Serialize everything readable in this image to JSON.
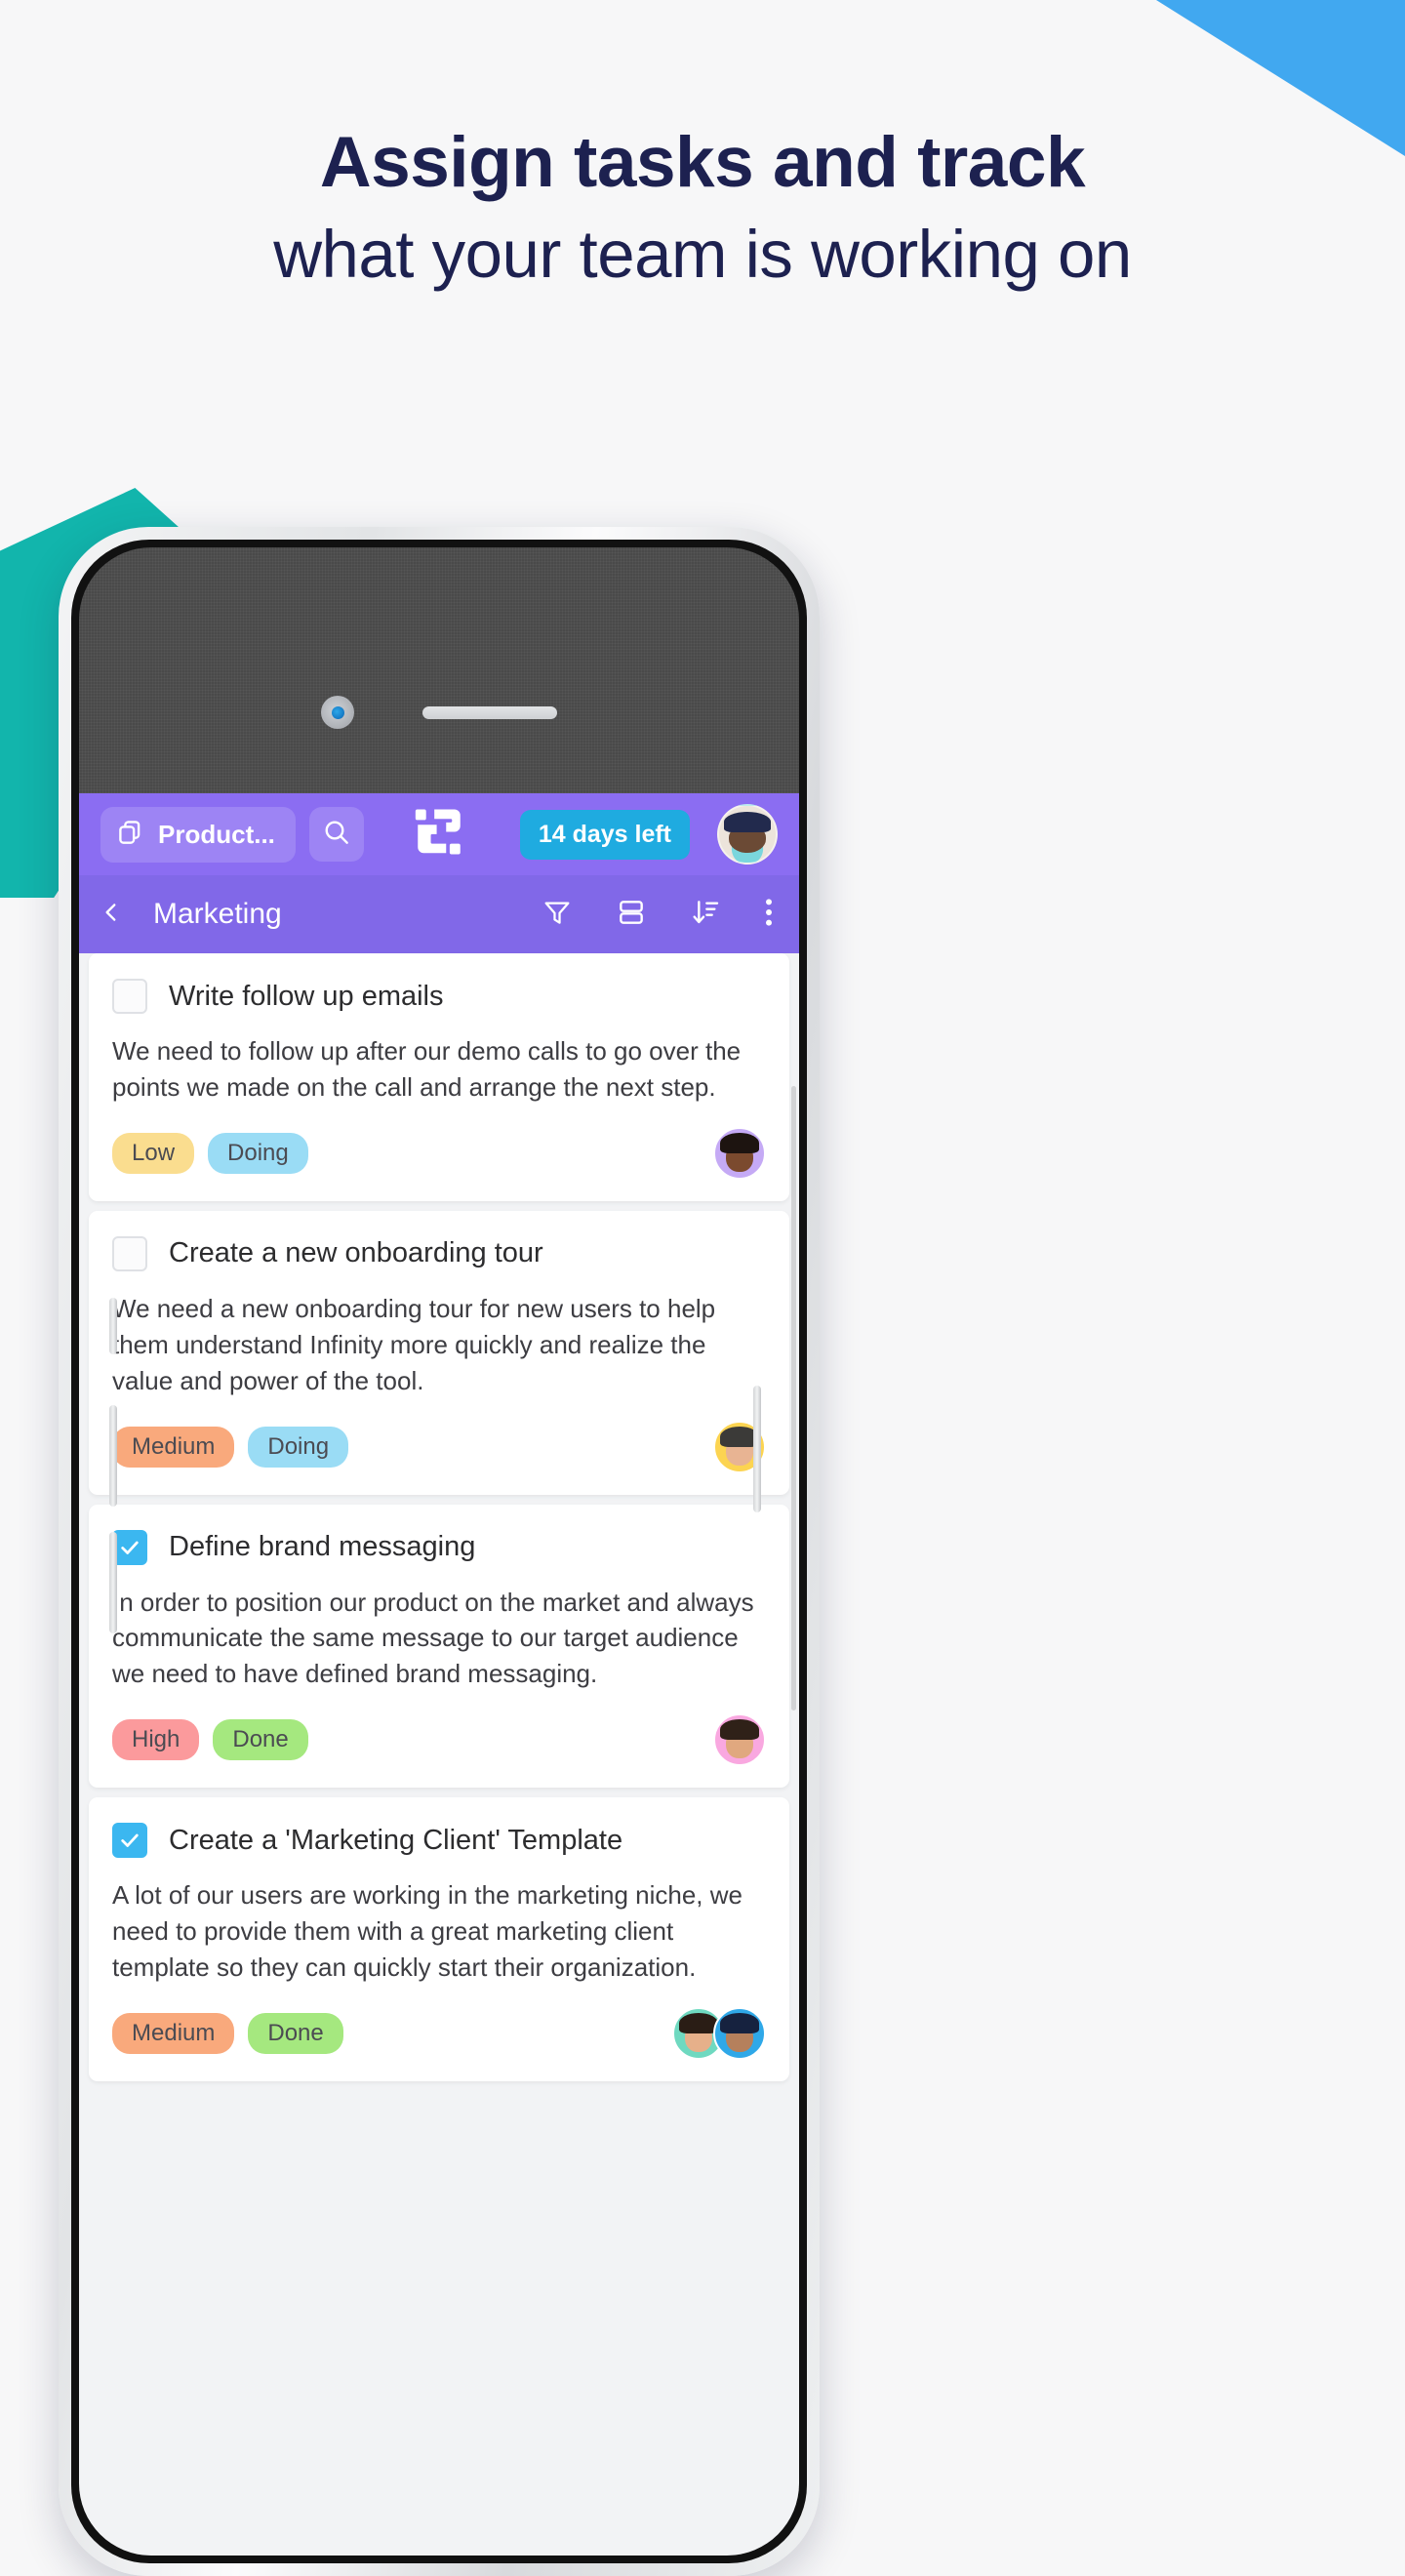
{
  "hero": {
    "headline": "Assign tasks and track",
    "subheadline": "what your team is working on"
  },
  "colors": {
    "brand_purple": "#8b6df2",
    "toolbar_purple": "#8168e8",
    "accent_blue": "#1fabe0",
    "checkbox_blue": "#3bb7f0",
    "deco_blue": "#41a8f0",
    "deco_teal": "#12b5ac",
    "headline_navy": "#1d2150",
    "tag_low": "#fadd8f",
    "tag_medium": "#f9a97c",
    "tag_high": "#fb9a9c",
    "tag_doing": "#9adcf5",
    "tag_done": "#a5e87f"
  },
  "app": {
    "header": {
      "board_label": "Product...",
      "board_icon": "copy-icon",
      "search_icon": "search-icon",
      "logo_icon": "infinity-logo-icon",
      "trial_badge": "14 days left",
      "avatar_icon": "user-avatar"
    },
    "toolbar": {
      "back_icon": "chevron-left-icon",
      "title": "Marketing",
      "filter_icon": "filter-icon",
      "group_icon": "group-rows-icon",
      "sort_icon": "sort-descending-icon",
      "more_icon": "more-vertical-icon"
    },
    "tasks": [
      {
        "checked": false,
        "title": "Write follow up emails",
        "description": "We need to follow up after our demo calls to go over the points we made on the call and arrange the next step.",
        "tags": [
          {
            "label": "Low",
            "color": "#fadd8f"
          },
          {
            "label": "Doing",
            "color": "#9adcf5"
          }
        ],
        "assignees": [
          {
            "skin": "#7b4a2e",
            "hair": "#1d1410",
            "bg": "#c5aaf5"
          }
        ]
      },
      {
        "checked": false,
        "title": "Create a new onboarding tour",
        "description": "We need a new onboarding tour for new users to help them understand Infinity more quickly and realize the value and power of the tool.",
        "tags": [
          {
            "label": "Medium",
            "color": "#f9a97c"
          },
          {
            "label": "Doing",
            "color": "#9adcf5"
          }
        ],
        "assignees": [
          {
            "skin": "#e8b493",
            "hair": "#3b3a38",
            "bg": "#fcd451"
          }
        ]
      },
      {
        "checked": true,
        "title": "Define brand messaging",
        "description": "In order to position our product on the market and always communicate the same message to our target audience we need to have defined brand messaging.",
        "tags": [
          {
            "label": "High",
            "color": "#fb9a9c"
          },
          {
            "label": "Done",
            "color": "#a5e87f"
          }
        ],
        "assignees": [
          {
            "skin": "#e0a87f",
            "hair": "#2f2118",
            "bg": "#f9a8e0"
          }
        ]
      },
      {
        "checked": true,
        "title": "Create a 'Marketing Client' Template",
        "description": "A lot of our users are working in the marketing niche, we need to provide them with a great marketing client template so they can quickly start their organization.",
        "tags": [
          {
            "label": "Medium",
            "color": "#f9a97c"
          },
          {
            "label": "Done",
            "color": "#a5e87f"
          }
        ],
        "assignees": [
          {
            "skin": "#e6b08a",
            "hair": "#2a1d15",
            "bg": "#6fd9c0"
          },
          {
            "skin": "#b5805c",
            "hair": "#16223f",
            "bg": "#2fa8e8"
          }
        ]
      }
    ]
  }
}
